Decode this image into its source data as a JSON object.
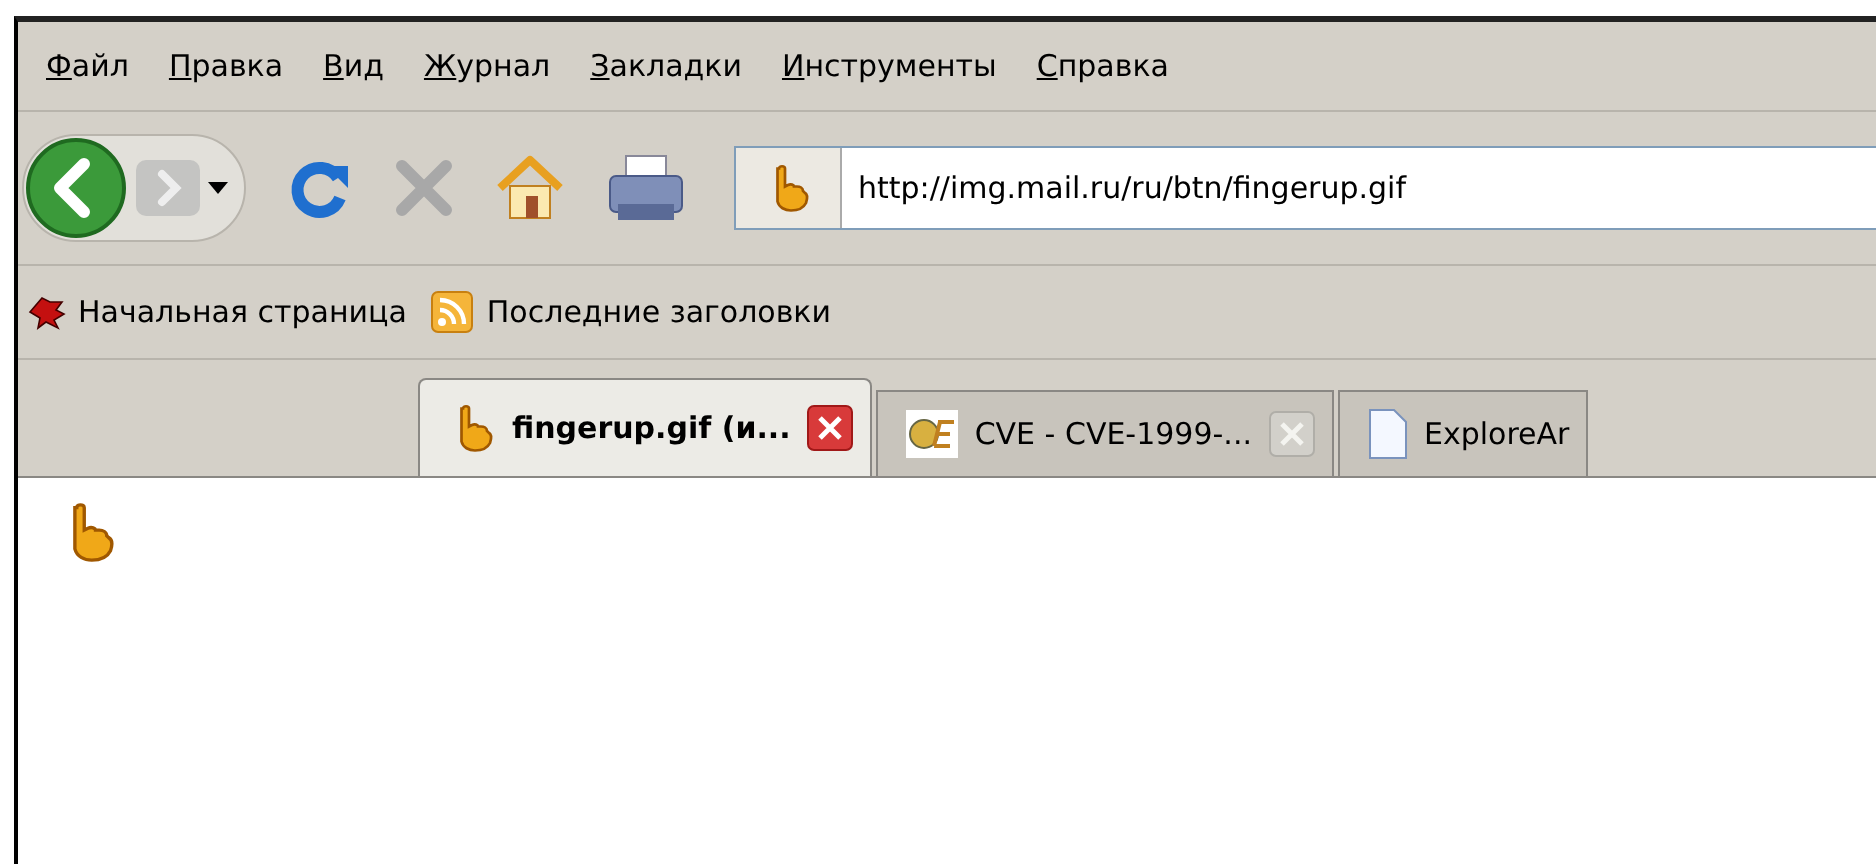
{
  "menu": [
    "Файл",
    "Правка",
    "Вид",
    "Журнал",
    "Закладки",
    "Инструменты",
    "Справка"
  ],
  "toolbar": {
    "back_enabled": true,
    "forward_enabled": false,
    "address": "http://img.mail.ru/ru/btn/fingerup.gif"
  },
  "bookmarks": [
    {
      "label": "Начальная страница"
    },
    {
      "label": "Последние заголовки"
    }
  ],
  "tabs": [
    {
      "title": "fingerup.gif (и...",
      "selected": true,
      "closable": true
    },
    {
      "title": "CVE - CVE-1999-...",
      "selected": false,
      "closable": true
    },
    {
      "title": "ExploreAr",
      "selected": false,
      "closable": false
    }
  ]
}
